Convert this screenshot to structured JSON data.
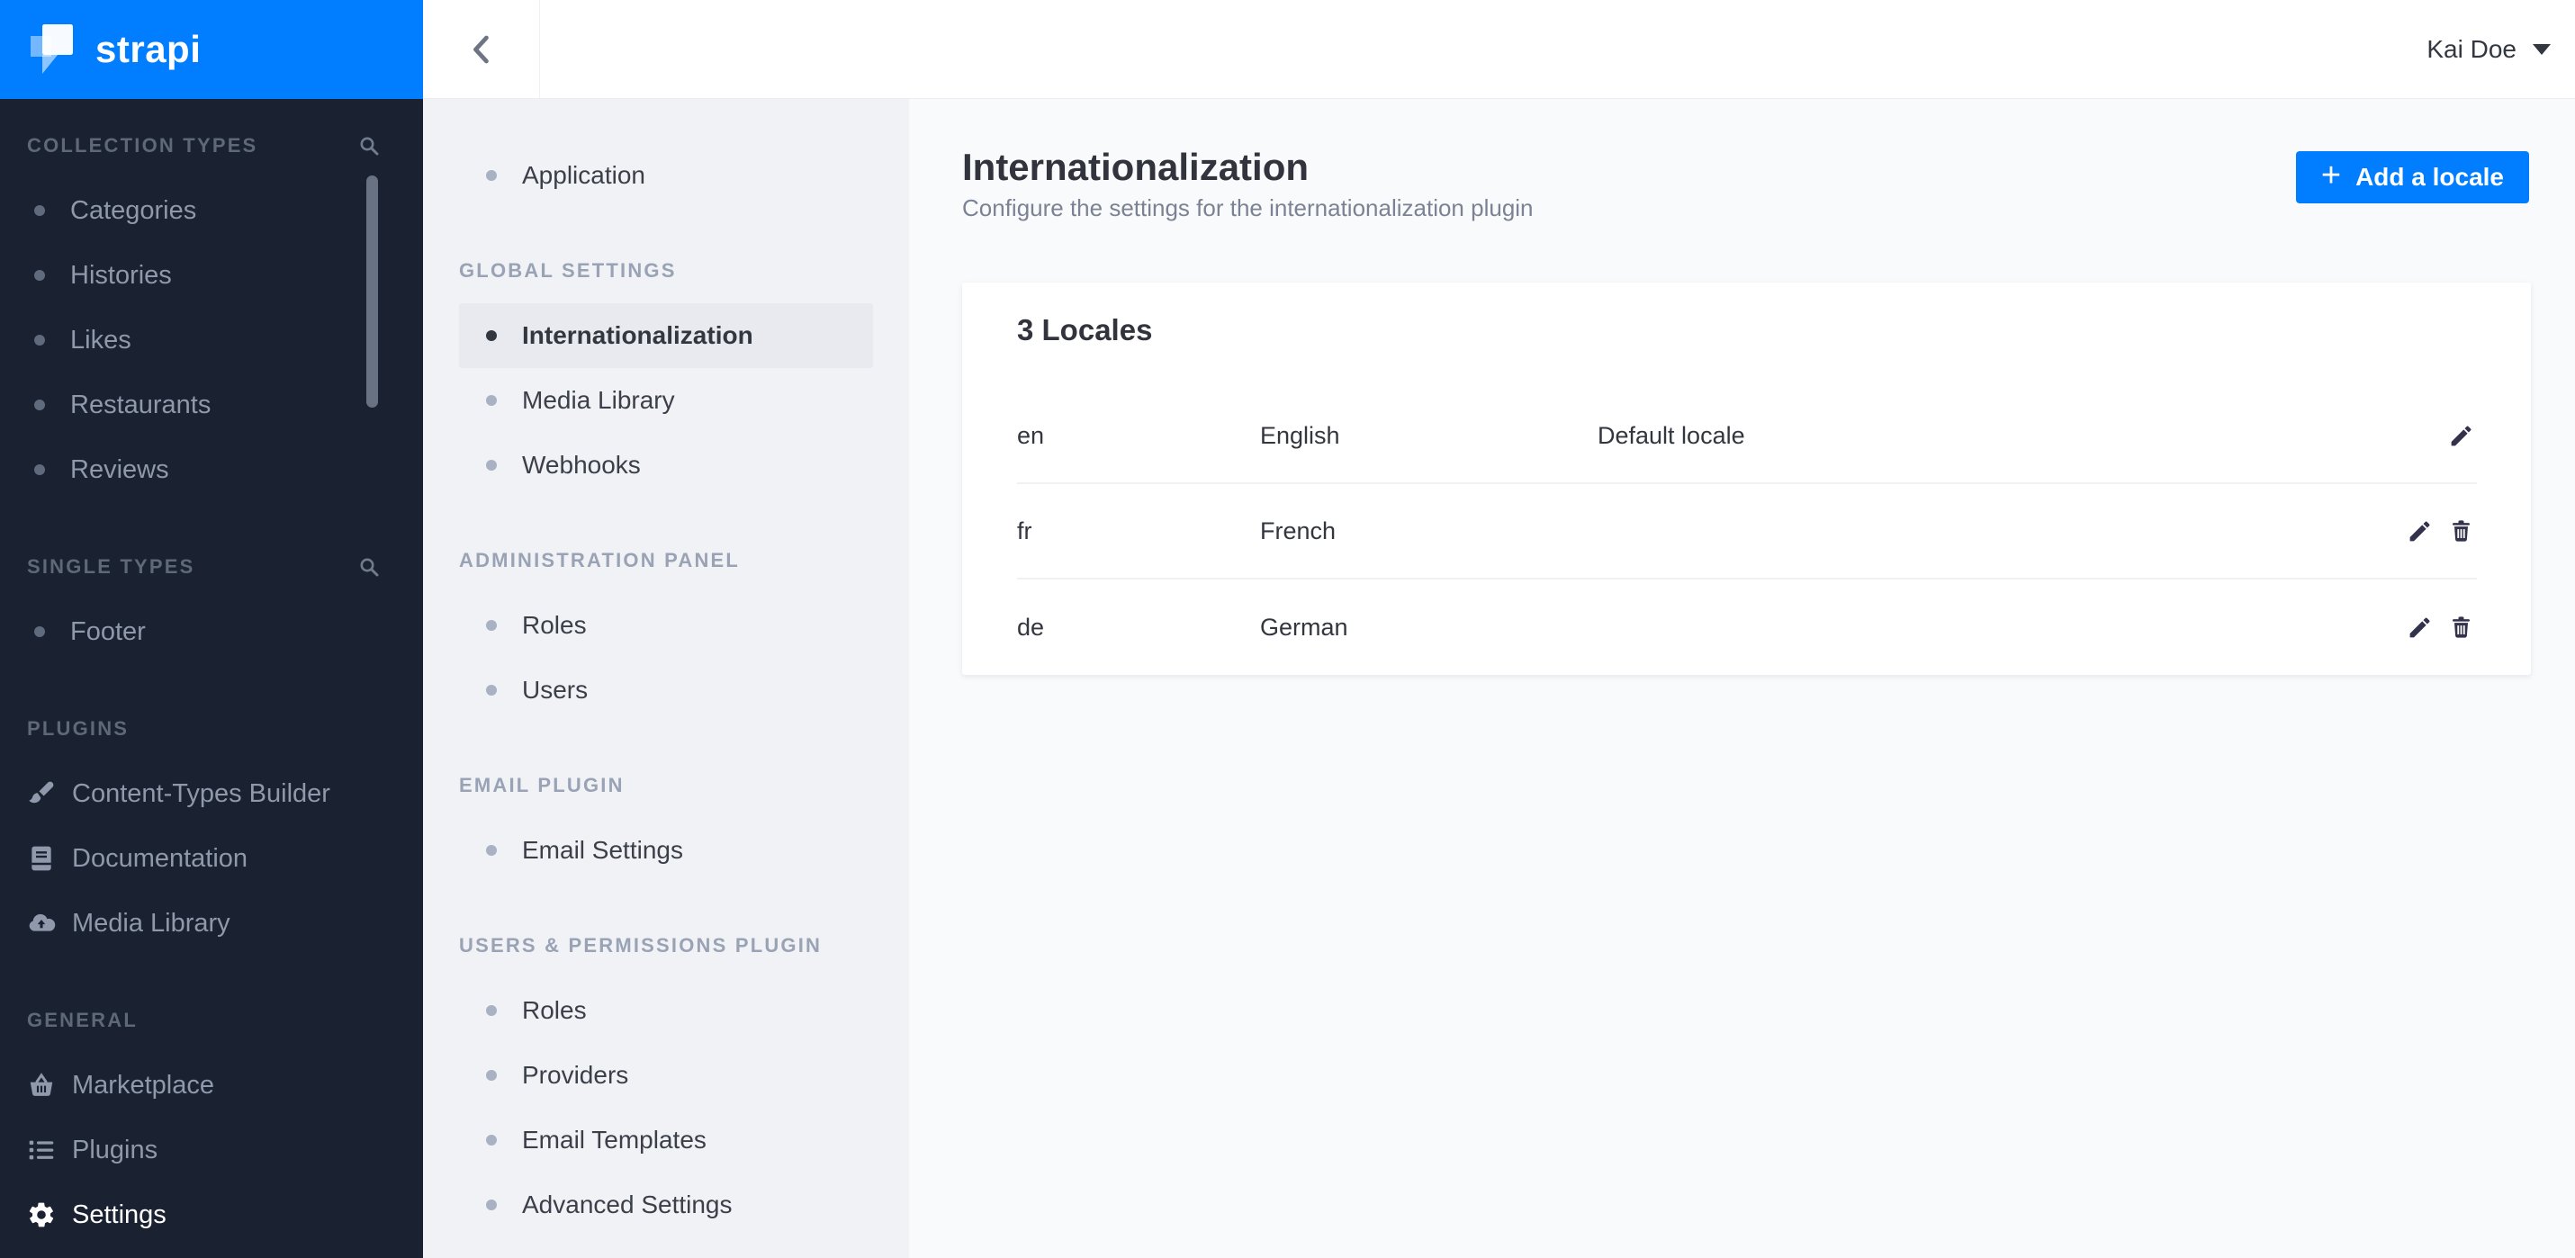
{
  "colors": {
    "accent_blue": "#007eff",
    "dark_sidebar_bg": "#1a2130",
    "settings_sidebar_bg": "#f1f2f5",
    "main_bg": "#f9fafb",
    "active_item_bg": "#e9eaef",
    "text_dark": "#333740",
    "text_muted": "#7b8294",
    "sidebar_item_text": "#8f99ab",
    "white": "#ffffff"
  },
  "icons": {
    "strapi-logo-icon": "strapi brand mark",
    "search-icon": "magnifier",
    "paintbrush-icon": "paint brush",
    "book-icon": "book",
    "cloud-upload-icon": "cloud with up arrow",
    "basket-icon": "shopping basket",
    "bullet-list-icon": "bulleted list",
    "gear-icon": "cog wheel",
    "chevron-left-icon": "left chevron",
    "caret-down-icon": "filled down triangle",
    "plus-icon": "+",
    "edit-icon": "pencil",
    "delete-icon": "trash can"
  },
  "brand": {
    "name": "strapi"
  },
  "dark_sidebar": {
    "sections": [
      {
        "header": "COLLECTION TYPES",
        "has_search": true,
        "items": [
          {
            "label": "Categories"
          },
          {
            "label": "Histories"
          },
          {
            "label": "Likes"
          },
          {
            "label": "Restaurants"
          },
          {
            "label": "Reviews"
          }
        ]
      },
      {
        "header": "SINGLE TYPES",
        "has_search": true,
        "items": [
          {
            "label": "Footer"
          }
        ]
      },
      {
        "header": "PLUGINS",
        "items": [
          {
            "label": "Content-Types Builder",
            "icon": "paintbrush-icon"
          },
          {
            "label": "Documentation",
            "icon": "book-icon"
          },
          {
            "label": "Media Library",
            "icon": "cloud-upload-icon"
          }
        ]
      },
      {
        "header": "GENERAL",
        "items": [
          {
            "label": "Marketplace",
            "icon": "basket-icon"
          },
          {
            "label": "Plugins",
            "icon": "bullet-list-icon"
          },
          {
            "label": "Settings",
            "icon": "gear-icon",
            "active": true
          }
        ]
      }
    ]
  },
  "topbar": {
    "back_icon": "chevron-left-icon",
    "user": {
      "name": "Kai Doe",
      "dropdown_icon": "caret-down-icon"
    }
  },
  "settings_nav": {
    "groups": [
      {
        "items": [
          {
            "label": "Application"
          }
        ]
      },
      {
        "header": "GLOBAL SETTINGS",
        "items": [
          {
            "label": "Internationalization",
            "active": true
          },
          {
            "label": "Media Library"
          },
          {
            "label": "Webhooks"
          }
        ]
      },
      {
        "header": "ADMINISTRATION PANEL",
        "items": [
          {
            "label": "Roles"
          },
          {
            "label": "Users"
          }
        ]
      },
      {
        "header": "EMAIL PLUGIN",
        "items": [
          {
            "label": "Email Settings"
          }
        ]
      },
      {
        "header": "USERS & PERMISSIONS PLUGIN",
        "items": [
          {
            "label": "Roles"
          },
          {
            "label": "Providers"
          },
          {
            "label": "Email Templates"
          },
          {
            "label": "Advanced Settings"
          }
        ]
      }
    ]
  },
  "main": {
    "title": "Internationalization",
    "subtitle": "Configure the settings for the internationalization plugin",
    "add_button": {
      "plus": "+",
      "label": "Add a locale"
    },
    "locales_card": {
      "title": "3 Locales",
      "rows": [
        {
          "code": "en",
          "name": "English",
          "note": "Default locale",
          "actions": [
            "edit"
          ]
        },
        {
          "code": "fr",
          "name": "French",
          "note": "",
          "actions": [
            "edit",
            "delete"
          ]
        },
        {
          "code": "de",
          "name": "German",
          "note": "",
          "actions": [
            "edit",
            "delete"
          ]
        }
      ]
    }
  }
}
